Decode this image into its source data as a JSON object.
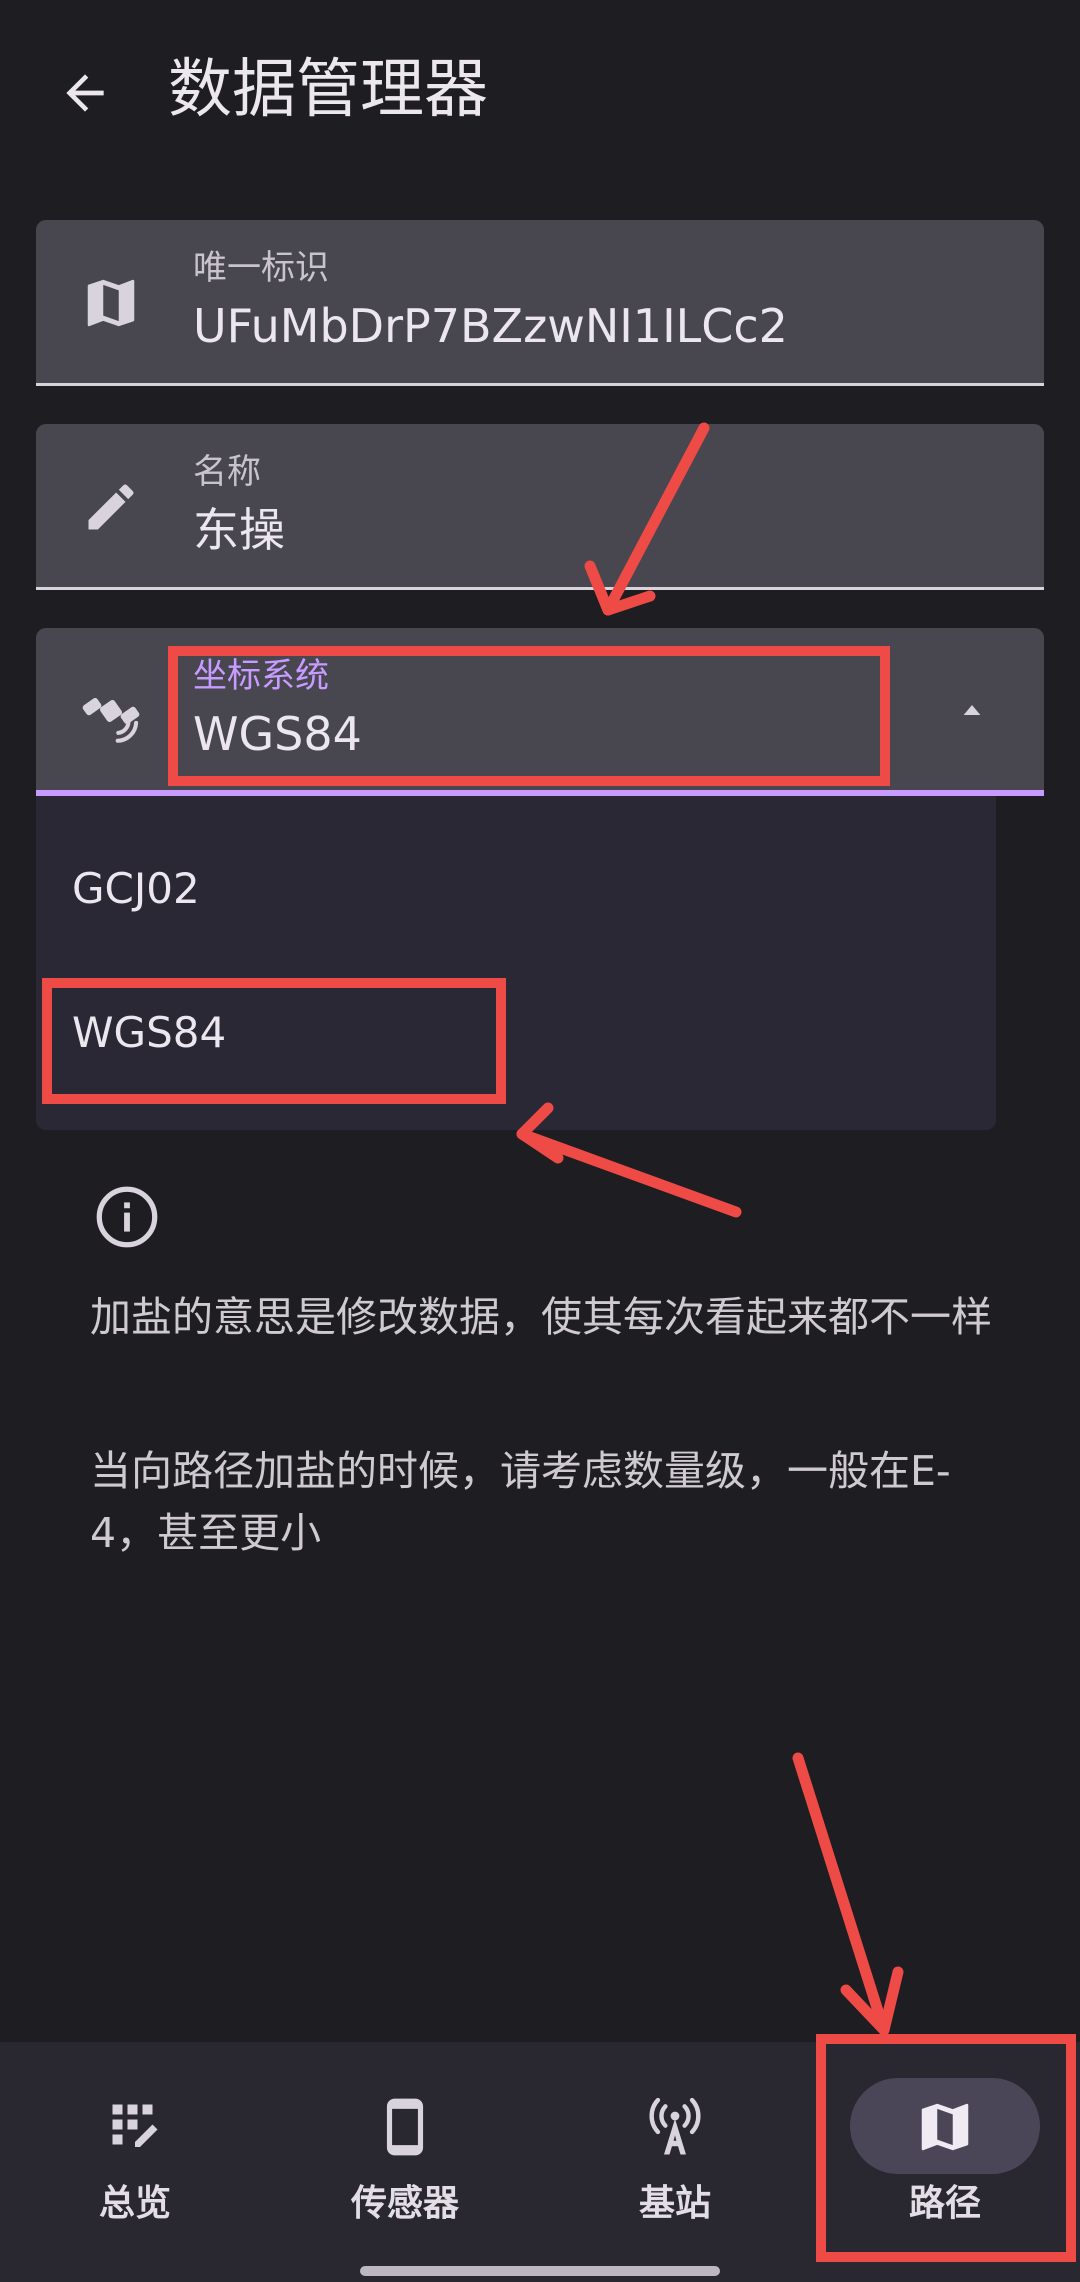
{
  "app_bar": {
    "title": "数据管理器"
  },
  "fields": {
    "uid": {
      "label": "唯一标识",
      "value": "UFuMbDrP7BZzwNI1ILCc2"
    },
    "name": {
      "label": "名称",
      "value": "东操"
    },
    "coord": {
      "label": "坐标系统",
      "value": "WGS84"
    }
  },
  "dropdown": {
    "options": [
      "GCJ02",
      "WGS84"
    ],
    "selected": "WGS84"
  },
  "info": {
    "paragraph1": "加盐的意思是修改数据，使其每次看起来都不一样",
    "paragraph2": "当向路径加盐的时候，请考虑数量级，一般在E-4，甚至更小"
  },
  "bottom_nav": {
    "items": [
      {
        "label": "总览",
        "icon": "dashboard-icon",
        "selected": false
      },
      {
        "label": "传感器",
        "icon": "phone-icon",
        "selected": false
      },
      {
        "label": "基站",
        "icon": "cell-tower-icon",
        "selected": false
      },
      {
        "label": "路径",
        "icon": "map-icon",
        "selected": true
      }
    ]
  },
  "colors": {
    "background": "#1e1d22",
    "field_bg": "#48464f",
    "accent": "#c79bff",
    "annotation_red": "#ee4a46"
  }
}
